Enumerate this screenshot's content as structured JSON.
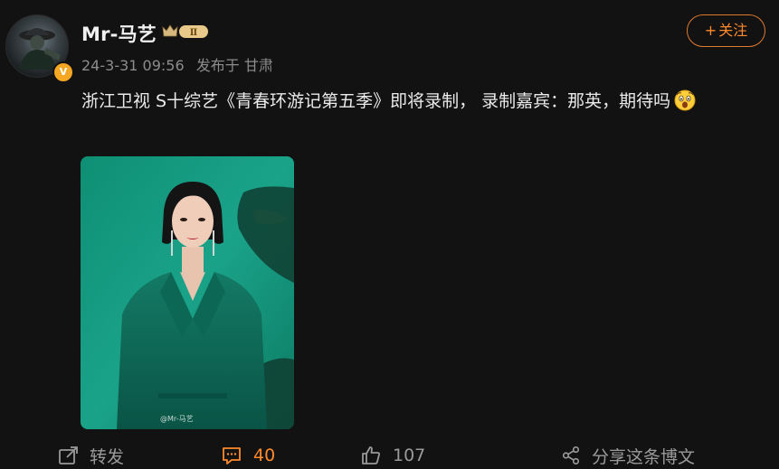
{
  "user": {
    "name": "Mr-马艺",
    "vip_level": "Ⅱ",
    "verified_mark": "V"
  },
  "post": {
    "date": "24-3-31 09:56",
    "location": "发布于 甘肃",
    "text": "浙江卫视 S十综艺《青春环游记第五季》即将录制， 录制嘉宾：那英，期待吗",
    "emoji_icon": "surprised-face-icon",
    "image_watermark": "@Mr-马艺"
  },
  "follow_button": {
    "label": "关注",
    "plus": "+"
  },
  "actions": {
    "repost_label": "转发",
    "comment_count": "40",
    "like_count": "107",
    "share_label": "分享这条博文"
  },
  "colors": {
    "background": "#121212",
    "accent_orange": "#ff8a2b",
    "photo_teal": "#1aa389"
  }
}
